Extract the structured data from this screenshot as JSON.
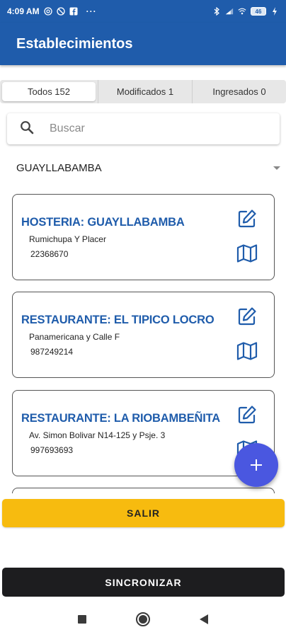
{
  "status_bar": {
    "time": "4:09 AM",
    "battery": "46"
  },
  "app_bar": {
    "title": "Establecimientos"
  },
  "tabs": [
    {
      "label": "Todos 152",
      "active": true
    },
    {
      "label": "Modificados 1",
      "active": false
    },
    {
      "label": "Ingresados 0",
      "active": false
    }
  ],
  "search": {
    "placeholder": "Buscar",
    "value": ""
  },
  "filter": {
    "selected": "GUAYLLABAMBA"
  },
  "establishments": [
    {
      "title": "HOSTERIA: GUAYLLABAMBA",
      "address": "Rumichupa Y Placer",
      "phone": "22368670"
    },
    {
      "title": "RESTAURANTE: EL TIPICO LOCRO",
      "address": "Panamericana y Calle F",
      "phone": "987249214"
    },
    {
      "title": "RESTAURANTE: LA RIOBAMBEÑITA",
      "address": "Av. Simon Bolivar N14-125 y Psje. 3",
      "phone": "997693693"
    },
    {
      "title": "",
      "address": "",
      "phone": ""
    }
  ],
  "buttons": {
    "salir": "SALIR",
    "sincronizar": "SINCRONIZAR"
  },
  "colors": {
    "primary": "#1f5cab",
    "fab": "#4a57e0",
    "salir": "#f7bb0f",
    "sincronizar": "#1d1d1f"
  }
}
